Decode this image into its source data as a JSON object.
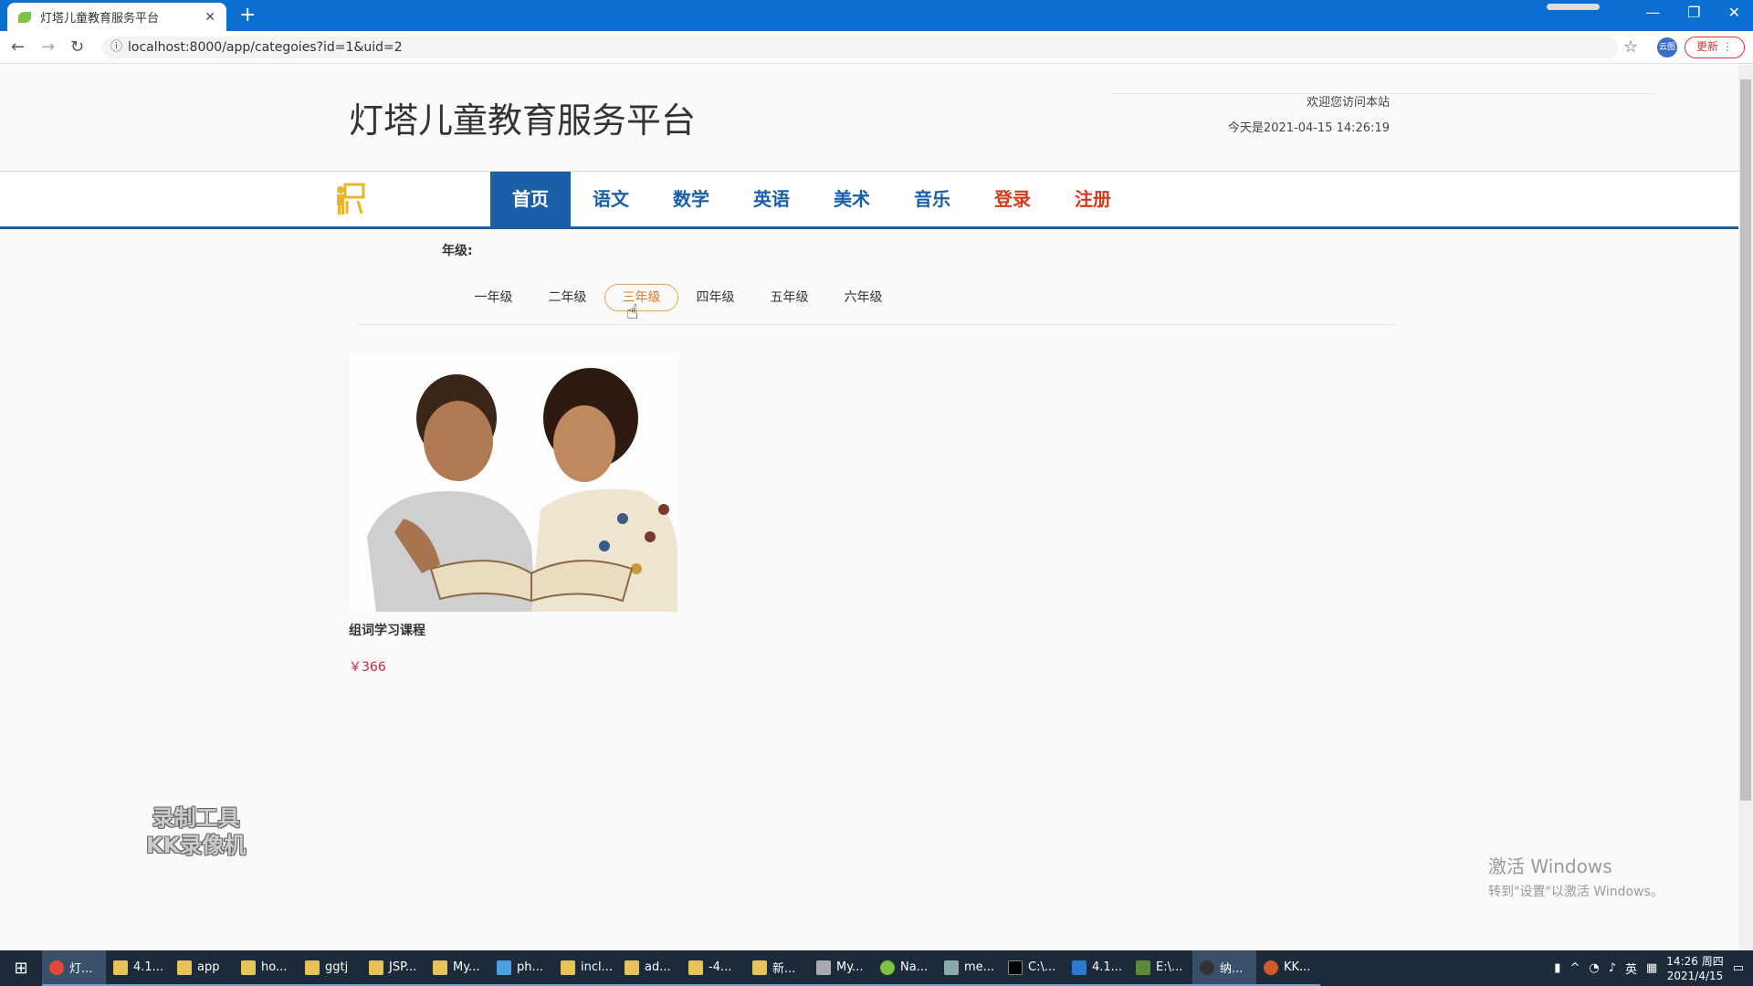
{
  "browser": {
    "tab_title": "灯塔儿童教育服务平台",
    "url": "localhost:8000/app/categoies?id=1&uid=2",
    "extension_label": "云图",
    "update_label": "更新"
  },
  "header": {
    "site_title": "灯塔儿童教育服务平台",
    "welcome": "欢迎您访问本站",
    "date": "今天是2021-04-15 14:26:19"
  },
  "nav": {
    "items": [
      {
        "label": "首页"
      },
      {
        "label": "语文"
      },
      {
        "label": "数学"
      },
      {
        "label": "英语"
      },
      {
        "label": "美术"
      },
      {
        "label": "音乐"
      },
      {
        "label": "登录"
      },
      {
        "label": "注册"
      }
    ]
  },
  "filter": {
    "grade_label": "年级:",
    "grades": [
      "一年级",
      "二年级",
      "三年级",
      "四年级",
      "五年级",
      "六年级"
    ],
    "selected": "三年级"
  },
  "courses": [
    {
      "name": "组词学习课程",
      "price": "￥366"
    }
  ],
  "overlay": {
    "watermark_line1": "录制工具",
    "watermark_line2": "KK录像机",
    "activate_title": "激活 Windows",
    "activate_sub": "转到\"设置\"以激活 Windows。"
  },
  "taskbar": {
    "items": [
      "灯...",
      "4.1...",
      "app",
      "ho...",
      "ggtj",
      "JSP...",
      "My...",
      "ph...",
      "incl...",
      "ad...",
      "-4...",
      "新...",
      "My...",
      "Na...",
      "me...",
      "C:\\...",
      "4.1...",
      "E:\\...",
      "纳...",
      "KK..."
    ],
    "ime": "英",
    "time": "14:26 周四",
    "date": "2021/4/15"
  },
  "colors": {
    "nav_blue": "#1a5fa8",
    "nav_red": "#d43b1b",
    "price_red": "#d0243d",
    "grade_active": "#e07b1f"
  }
}
